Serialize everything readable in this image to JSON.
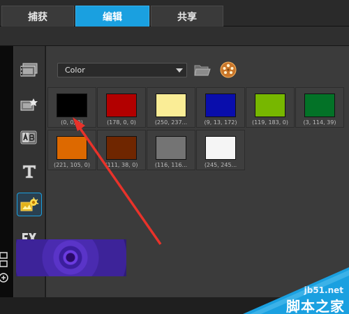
{
  "tabs": [
    {
      "label": "捕获",
      "active": false
    },
    {
      "label": "编辑",
      "active": true
    },
    {
      "label": "共享",
      "active": false
    }
  ],
  "sidebar": {
    "icons": [
      {
        "name": "media-icon",
        "active": false
      },
      {
        "name": "instant-project-icon",
        "active": false
      },
      {
        "name": "transition-icon",
        "active": false
      },
      {
        "name": "title-icon",
        "active": false
      },
      {
        "name": "graphics-icon",
        "active": true
      },
      {
        "name": "fx-icon",
        "active": false
      }
    ]
  },
  "library": {
    "dropdown_value": "Color",
    "colors": [
      {
        "hex": "#000000",
        "label": "(0, 0, 0)"
      },
      {
        "hex": "#b20000",
        "label": "(178, 0, 0)"
      },
      {
        "hex": "#faed96",
        "label": "(250, 237..."
      },
      {
        "hex": "#090dac",
        "label": "(9, 13, 172)"
      },
      {
        "hex": "#77b700",
        "label": "(119, 183, 0)"
      },
      {
        "hex": "#037227",
        "label": "(3, 114, 39)"
      },
      {
        "hex": "#dd6900",
        "label": "(221, 105, 0)"
      },
      {
        "hex": "#6f2600",
        "label": "(111, 38, 0)"
      },
      {
        "hex": "#747474",
        "label": "(116, 116..."
      },
      {
        "hex": "#f5f5f5",
        "label": "(245, 245..."
      }
    ]
  },
  "watermark": {
    "url": "jb51.net",
    "text": "脚本之家"
  }
}
